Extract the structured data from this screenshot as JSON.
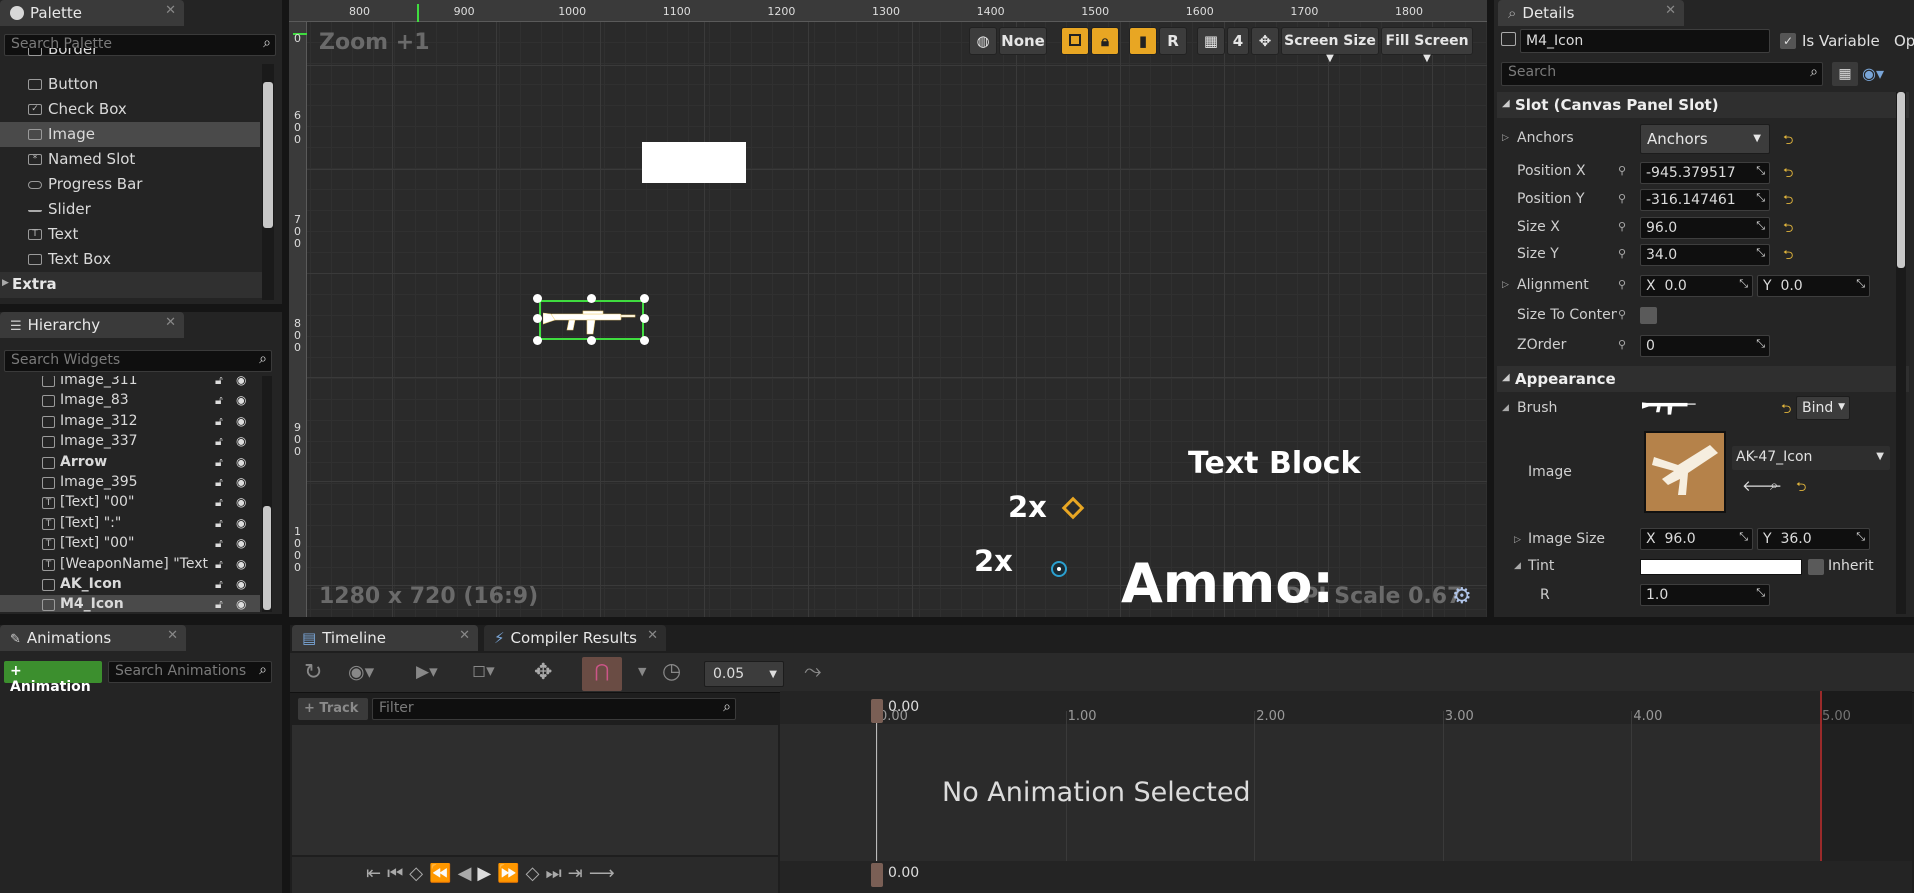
{
  "palette": {
    "tab_label": "Palette",
    "search_placeholder": "Search Palette",
    "items": [
      "Border",
      "Button",
      "Check Box",
      "Image",
      "Named Slot",
      "Progress Bar",
      "Slider",
      "Text",
      "Text Box"
    ],
    "category": "Extra"
  },
  "hierarchy": {
    "tab_label": "Hierarchy",
    "search_placeholder": "Search Widgets",
    "rows": [
      "Image_311",
      "Image_83",
      "Image_312",
      "Image_337",
      "Arrow",
      "Image_395",
      "[Text] \"00\"",
      "[Text] \":\"",
      "[Text] \"00\"",
      "[WeaponName] \"Text Bl",
      "AK_Icon",
      "M4_Icon"
    ]
  },
  "designer": {
    "zoom_label": "Zoom +1",
    "resolution_label": "1280 x 720 (16:9)",
    "dpi_label": "DPI Scale 0.67",
    "toolbar": {
      "none_label": "None",
      "r_label": "R",
      "grid_value": "4",
      "screen_size_label": "Screen Size",
      "fill_screen_label": "Fill Screen"
    },
    "ruler_h": [
      "800",
      "900",
      "1000",
      "1100",
      "1200",
      "1300",
      "1400",
      "1500",
      "1600",
      "1700",
      "1800"
    ],
    "ruler_v": [
      "6\n0\n0",
      "7\n0\n0",
      "8\n0\n0",
      "9\n0\n0",
      "1\n0\n0\n0"
    ],
    "canvas_texts": {
      "text_block": "Text Block",
      "multiplier_1": "2x",
      "multiplier_2": "2x",
      "ammo": "Ammo:"
    }
  },
  "details": {
    "tab_label": "Details",
    "name_value": "M4_Icon",
    "is_variable_label": "Is Variable",
    "search_placeholder": "Search",
    "slot_section": "Slot (Canvas Panel Slot)",
    "anchors_label": "Anchors",
    "anchors_value": "Anchors",
    "position_x_label": "Position X",
    "position_x_value": "-945.379517",
    "position_y_label": "Position Y",
    "position_y_value": "-316.147461",
    "size_x_label": "Size X",
    "size_x_value": "96.0",
    "size_y_label": "Size Y",
    "size_y_value": "34.0",
    "alignment_label": "Alignment",
    "alignment_x": "0.0",
    "alignment_y": "0.0",
    "size_to_content_label": "Size To Content",
    "zorder_label": "ZOrder",
    "zorder_value": "0",
    "appearance_section": "Appearance",
    "brush_label": "Brush",
    "bind_label": "Bind",
    "image_label": "Image",
    "image_asset": "AK-47_Icon",
    "image_size_label": "Image Size",
    "image_size_x": "96.0",
    "image_size_y": "36.0",
    "tint_label": "Tint",
    "inherit_label": "Inherit",
    "r_label": "R",
    "r_value": "1.0",
    "overflow_tab": "Op"
  },
  "animations": {
    "tab_label": "Animations",
    "add_button": "+ Animation",
    "search_placeholder": "Search Animations"
  },
  "timeline": {
    "tab_label": "Timeline",
    "compiler_tab_label": "Compiler Results",
    "snap_value": "0.05",
    "track_button": "+ Track",
    "filter_placeholder": "Filter",
    "playhead_value": "0.00",
    "ticks": [
      "0.00",
      "1.00",
      "2.00",
      "3.00",
      "4.00",
      "5.00"
    ],
    "empty_message": "No Animation Selected"
  },
  "colors": {
    "accent_orange": "#e8a623",
    "selection_green": "#3fdc3f",
    "add_button_green": "#3c8f2e",
    "end_marker_red": "#9a2a2a"
  }
}
